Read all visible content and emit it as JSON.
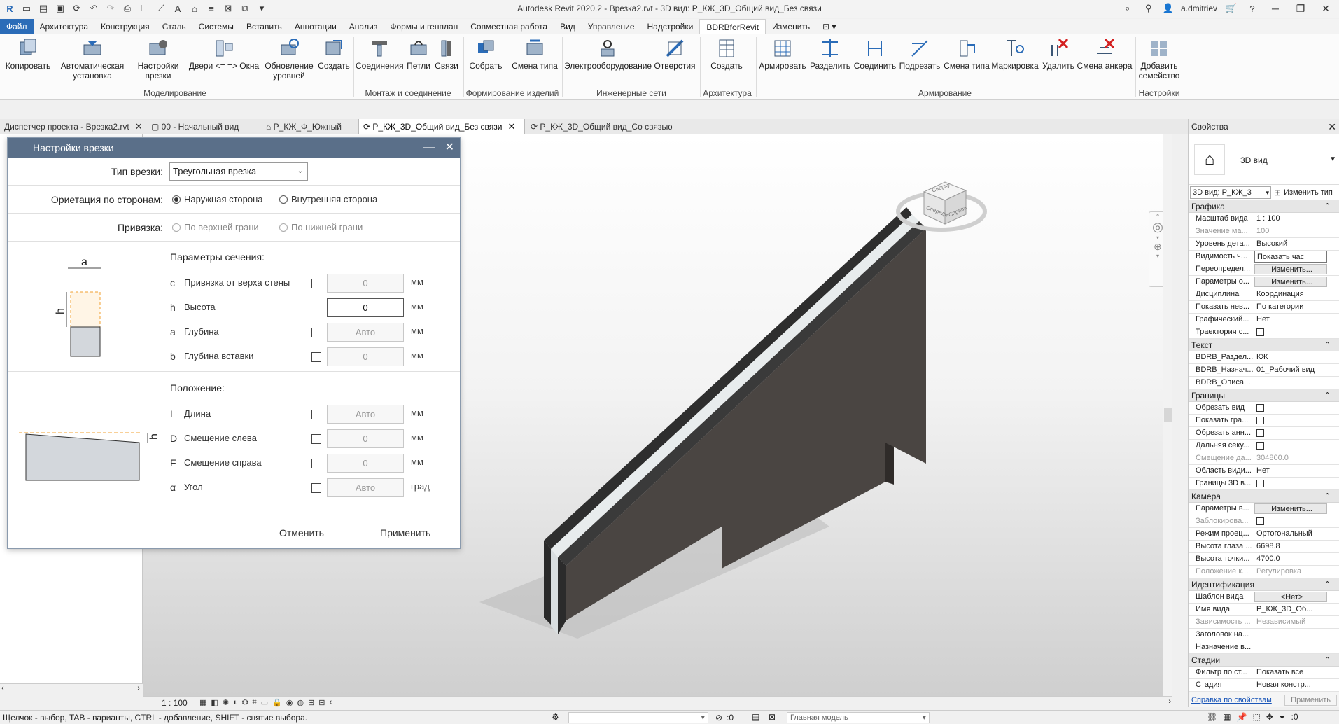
{
  "titlebar": {
    "title": "Autodesk Revit 2020.2 - Врезка2.rvt - 3D вид: Р_КЖ_3D_Общий вид_Без связи",
    "user": "a.dmitriev"
  },
  "ribbon_tabs": [
    "Файл",
    "Архитектура",
    "Конструкция",
    "Сталь",
    "Системы",
    "Вставить",
    "Аннотации",
    "Анализ",
    "Формы и генплан",
    "Совместная работа",
    "Вид",
    "Управление",
    "Надстройки",
    "BDRBforRevit",
    "Изменить"
  ],
  "ribbon": {
    "buttons": [
      {
        "label": "Копировать",
        "icon": "copy-icon"
      },
      {
        "label": "Автоматическая установка",
        "icon": "auto-install-icon"
      },
      {
        "label": "Настройки врезки",
        "icon": "cut-settings-icon"
      },
      {
        "label": "Двери <= => Окна",
        "icon": "doors-windows-icon"
      },
      {
        "label": "Обновление уровней",
        "icon": "levels-update-icon"
      },
      {
        "label": "Создать",
        "icon": "create-icon"
      },
      {
        "label": "Соединения",
        "icon": "connections-icon"
      },
      {
        "label": "Петли",
        "icon": "loops-icon"
      },
      {
        "label": "Связи",
        "icon": "links-icon"
      },
      {
        "label": "Собрать",
        "icon": "assemble-icon"
      },
      {
        "label": "Смена типа",
        "icon": "change-type-icon"
      },
      {
        "label": "Электрооборудование",
        "icon": "electrical-icon"
      },
      {
        "label": "Отверстия",
        "icon": "openings-icon"
      },
      {
        "label": "Создать",
        "icon": "create-arch-icon"
      },
      {
        "label": "Армировать",
        "icon": "reinforce-icon"
      },
      {
        "label": "Разделить",
        "icon": "split-icon"
      },
      {
        "label": "Соединить",
        "icon": "join-icon"
      },
      {
        "label": "Подрезать",
        "icon": "trim-icon"
      },
      {
        "label": "Смена типа",
        "icon": "change-type-rebar-icon"
      },
      {
        "label": "Маркировка",
        "icon": "marking-icon"
      },
      {
        "label": "Удалить",
        "icon": "delete-icon"
      },
      {
        "label": "Смена анкера",
        "icon": "anchor-change-icon"
      },
      {
        "label": "Добавить семейство",
        "icon": "add-family-icon"
      }
    ],
    "groups": [
      "Моделирование",
      "Монтаж и соединение",
      "Формирование изделий",
      "Инженерные сети",
      "Архитектура",
      "Армирование",
      "Настройки"
    ]
  },
  "doc_tabs": [
    {
      "label": "Диспетчер проекта - Врезка2.rvt"
    },
    {
      "label": "00 - Начальный вид"
    },
    {
      "label": "Р_КЖ_Ф_Южный"
    },
    {
      "label": "Р_КЖ_3D_Общий вид_Без связи"
    },
    {
      "label": "Р_КЖ_3D_Общий вид_Со связью"
    }
  ],
  "viewport": {
    "scale": "1 : 100",
    "viewcube_front": "Спереди",
    "viewcube_right": "Справа",
    "viewcube_top": "Сверху"
  },
  "dialog": {
    "title": "Настройки врезки",
    "type_label": "Тип врезки:",
    "type_value": "Треугольная врезка",
    "orient_label": "Ориетация по сторонам:",
    "orient_outer": "Наружная сторона",
    "orient_inner": "Внутренняя сторона",
    "bind_label": "Привязка:",
    "bind_top": "По верхней грани",
    "bind_bottom": "По нижней грани",
    "section_title": "Параметры сечения:",
    "section_params": [
      {
        "sym": "c",
        "name": "Привязка от верха стены",
        "value": "0",
        "unit": "мм"
      },
      {
        "sym": "h",
        "name": "Высота",
        "value": "0",
        "unit": "мм"
      },
      {
        "sym": "a",
        "name": "Глубина",
        "value": "Авто",
        "unit": "мм"
      },
      {
        "sym": "b",
        "name": "Глубина вставки",
        "value": "0",
        "unit": "мм"
      }
    ],
    "position_title": "Положение:",
    "position_params": [
      {
        "sym": "L",
        "name": "Длина",
        "value": "Авто",
        "unit": "мм"
      },
      {
        "sym": "D",
        "name": "Смещение слева",
        "value": "0",
        "unit": "мм"
      },
      {
        "sym": "F",
        "name": "Смещение справа",
        "value": "0",
        "unit": "мм"
      },
      {
        "sym": "α",
        "name": "Угол",
        "value": "Авто",
        "unit": "град"
      }
    ],
    "diagram_a": "a",
    "diagram_h": "h",
    "diagram_h2": "h",
    "cancel": "Отменить",
    "apply": "Применить"
  },
  "properties": {
    "title": "Свойства",
    "type_name": "3D вид",
    "selector": "3D вид: Р_КЖ_3",
    "edit_type": "Изменить тип",
    "sections": [
      {
        "name": "Графика",
        "rows": [
          {
            "n": "Масштаб вида",
            "v": "1 : 100"
          },
          {
            "n": "Значение ма...",
            "v": "100",
            "dis": true
          },
          {
            "n": "Уровень дета...",
            "v": "Высокий"
          },
          {
            "n": "Видимость ч...",
            "v": "Показать час",
            "boxed": true
          },
          {
            "n": "Переопредел...",
            "v": "Изменить...",
            "btn": true
          },
          {
            "n": "Параметры о...",
            "v": "Изменить...",
            "btn": true
          },
          {
            "n": "Дисциплина",
            "v": "Координация"
          },
          {
            "n": "Показать нев...",
            "v": "По категории"
          },
          {
            "n": "Графический...",
            "v": "Нет"
          },
          {
            "n": "Траектория с...",
            "v": "",
            "chk": true
          }
        ]
      },
      {
        "name": "Текст",
        "rows": [
          {
            "n": "BDRB_Раздел...",
            "v": "КЖ"
          },
          {
            "n": "BDRB_Назнач...",
            "v": "01_Рабочий вид"
          },
          {
            "n": "BDRB_Описа...",
            "v": ""
          }
        ]
      },
      {
        "name": "Границы",
        "rows": [
          {
            "n": "Обрезать вид",
            "v": "",
            "chk": true
          },
          {
            "n": "Показать гра...",
            "v": "",
            "chk": true
          },
          {
            "n": "Обрезать анн...",
            "v": "",
            "chk": true
          },
          {
            "n": "Дальняя секу...",
            "v": "",
            "chk": true
          },
          {
            "n": "Смещение да...",
            "v": "304800.0",
            "dis": true
          },
          {
            "n": "Область види...",
            "v": "Нет"
          },
          {
            "n": "Границы 3D в...",
            "v": "",
            "chk": true
          }
        ]
      },
      {
        "name": "Камера",
        "rows": [
          {
            "n": "Параметры в...",
            "v": "Изменить...",
            "btn": true
          },
          {
            "n": "Заблокирова...",
            "v": "",
            "chk": true,
            "dis": true
          },
          {
            "n": "Режим проец...",
            "v": "Ортогональный"
          },
          {
            "n": "Высота глаза ...",
            "v": "6698.8"
          },
          {
            "n": "Высота точки...",
            "v": "4700.0"
          },
          {
            "n": "Положение к...",
            "v": "Регулировка",
            "dis": true
          }
        ]
      },
      {
        "name": "Идентификация",
        "rows": [
          {
            "n": "Шаблон вида",
            "v": "<Нет>",
            "btn": true
          },
          {
            "n": "Имя вида",
            "v": "Р_КЖ_3D_Об..."
          },
          {
            "n": "Зависимость ...",
            "v": "Независимый",
            "dis": true
          },
          {
            "n": "Заголовок на...",
            "v": ""
          },
          {
            "n": "Назначение в...",
            "v": ""
          }
        ]
      },
      {
        "name": "Стадии",
        "rows": [
          {
            "n": "Фильтр по ст...",
            "v": "Показать все"
          },
          {
            "n": "Стадия",
            "v": "Новая констр..."
          }
        ]
      }
    ],
    "help_link": "Справка по свойствам",
    "apply": "Применить"
  },
  "statusbar": {
    "message": "Щелчок - выбор, TAB - варианты, CTRL - добавление, SHIFT - снятие выбора.",
    "count": ":0",
    "model": "Главная модель",
    "filter_count": ":0"
  }
}
